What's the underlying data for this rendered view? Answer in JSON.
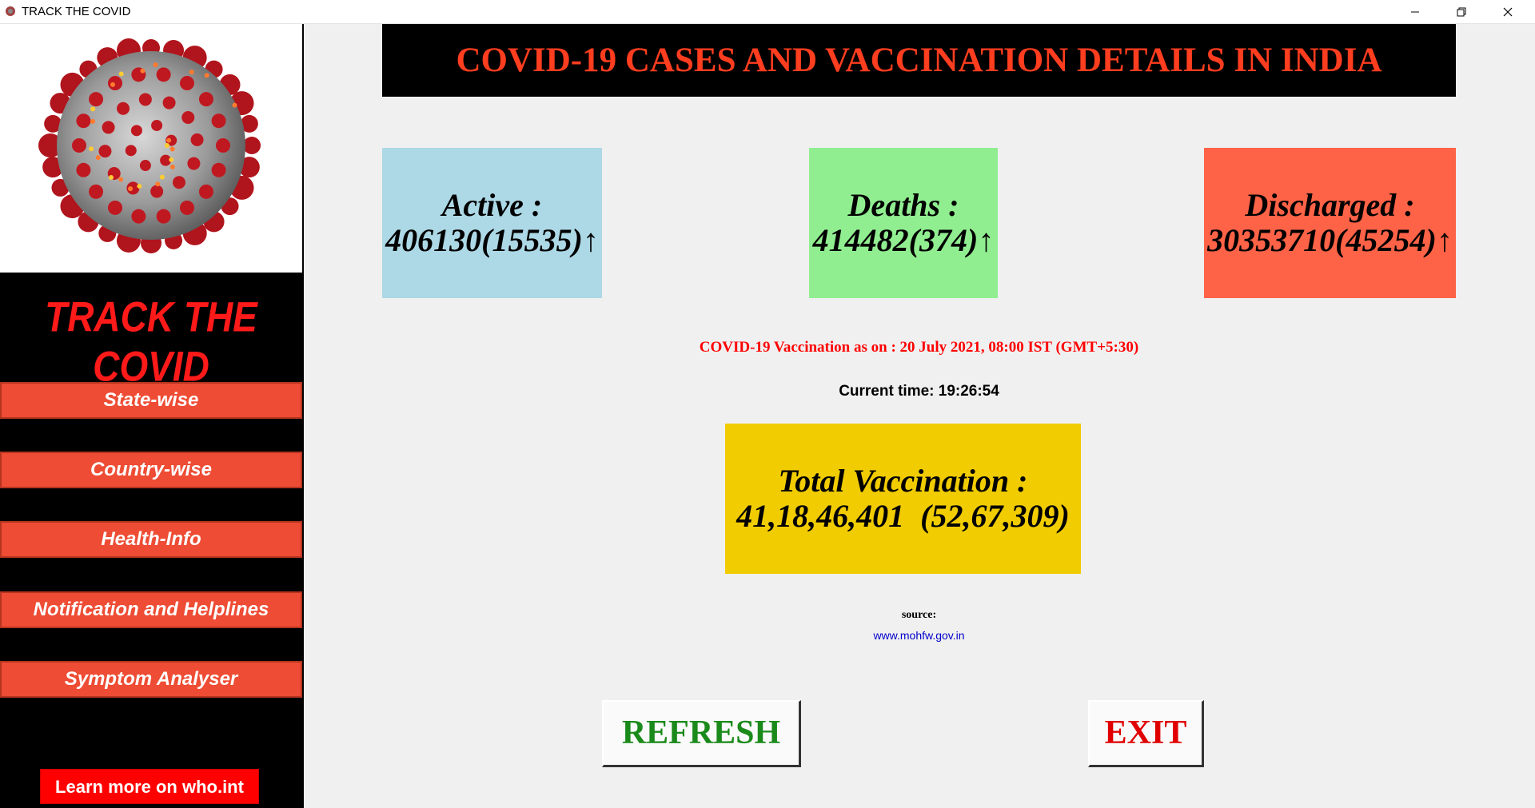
{
  "window": {
    "title": "TRACK THE COVID"
  },
  "sidebar": {
    "brand": "TRACK THE COVID",
    "nav": [
      {
        "label": "State-wise"
      },
      {
        "label": "Country-wise"
      },
      {
        "label": "Health-Info"
      },
      {
        "label": "Notification and Helplines"
      },
      {
        "label": "Symptom Analyser"
      }
    ],
    "who_link": "Learn more on who.int"
  },
  "main": {
    "heading": "COVID-19 CASES AND VACCINATION DETAILS IN INDIA",
    "stats": {
      "active": {
        "label": "Active :",
        "value": "406130(15535)",
        "arrow": "↑",
        "color": "#add8e6"
      },
      "deaths": {
        "label": "Deaths :",
        "value": "414482(374)",
        "arrow": "↑",
        "color": "#90ee90"
      },
      "discharged": {
        "label": "Discharged :",
        "value": "30353710(45254)",
        "arrow": "↑",
        "color": "#ff6347"
      }
    },
    "vaccination_asof": "COVID-19 Vaccination as on : 20 July 2021, 08:00 IST (GMT+5:30)",
    "current_time": "Current time: 19:26:54",
    "total_vaccination": {
      "label": "Total Vaccination :",
      "value": "41,18,46,401  (52,67,309)",
      "color": "#f0cc00"
    },
    "source_label": "source:",
    "source_url": "www.mohfw.gov.in",
    "refresh_label": "REFRESH",
    "exit_label": "EXIT"
  },
  "colors": {
    "accent_red": "#ff3d1f",
    "nav_button": "#ee4c34",
    "refresh_text": "#1a8a1a",
    "exit_text": "#e00000"
  }
}
